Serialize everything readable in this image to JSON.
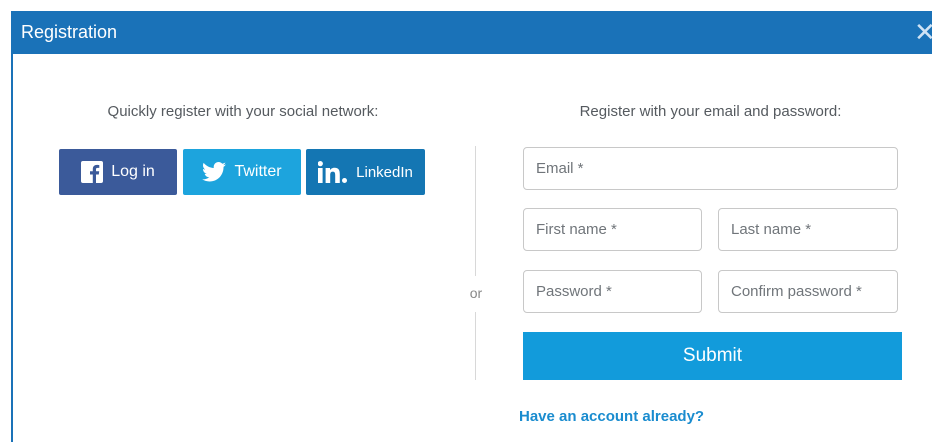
{
  "dialog": {
    "title": "Registration",
    "close_glyph": "✕"
  },
  "social": {
    "heading": "Quickly register with your social network:",
    "buttons": [
      {
        "icon": "facebook-icon",
        "label": "Log in",
        "color": "#3b5a9a"
      },
      {
        "icon": "twitter-icon",
        "label": "Twitter",
        "color": "#1da4dd"
      },
      {
        "icon": "linkedin-icon",
        "label": "LinkedIn",
        "color": "#1476b3"
      }
    ]
  },
  "separator": {
    "label": "or"
  },
  "email_form": {
    "heading": "Register with your email and password:",
    "fields": {
      "email": {
        "placeholder": "Email *",
        "value": ""
      },
      "first_name": {
        "placeholder": "First name *",
        "value": ""
      },
      "last_name": {
        "placeholder": "Last name *",
        "value": ""
      },
      "password": {
        "placeholder": "Password *",
        "value": ""
      },
      "confirm_password": {
        "placeholder": "Confirm password *",
        "value": ""
      }
    },
    "submit_label": "Submit",
    "have_account_link": "Have an account already?"
  },
  "colors": {
    "header_blue": "#1a72b8",
    "submit_blue": "#129bdb",
    "link_blue": "#1a8ccf"
  }
}
